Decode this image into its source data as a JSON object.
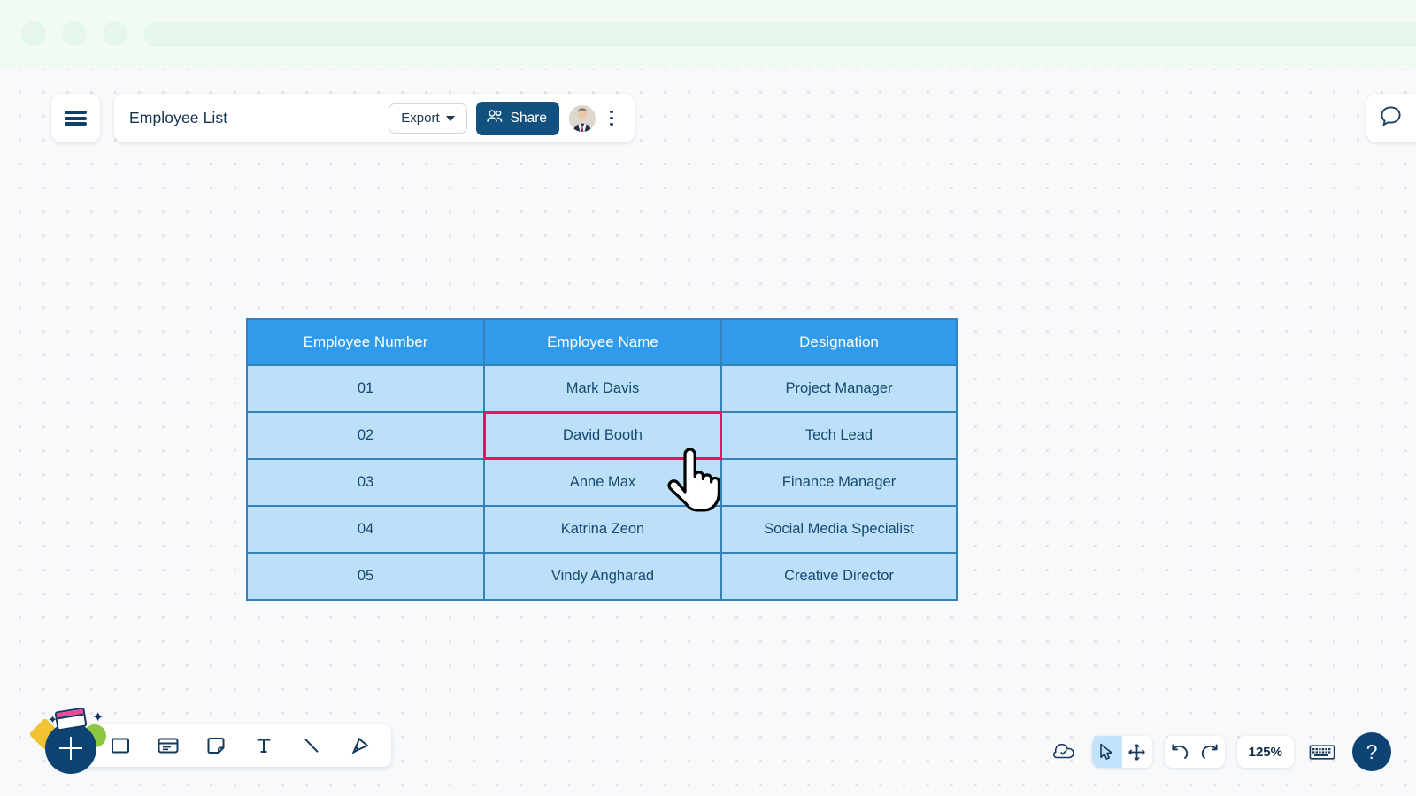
{
  "window": {
    "chrome_dots": [
      "minimize",
      "maximize",
      "close"
    ]
  },
  "toolbar": {
    "menu_icon": "hamburger-menu-icon",
    "doc_title": "Employee List",
    "export_label": "Export",
    "export_caret_icon": "chevron-down-icon",
    "share_label": "Share",
    "share_icon": "people-icon",
    "avatar_name": "user-avatar",
    "more_icon": "kebab-menu-icon",
    "comment_icon": "comment-bubble-icon"
  },
  "table": {
    "headers": [
      "Employee Number",
      "Employee Name",
      "Designation"
    ],
    "rows": [
      [
        "01",
        "Mark Davis",
        "Project Manager"
      ],
      [
        "02",
        "David Booth",
        "Tech Lead"
      ],
      [
        "03",
        "Anne Max",
        "Finance Manager"
      ],
      [
        "04",
        "Katrina Zeon",
        "Social Media Specialist"
      ],
      [
        "05",
        "Vindy Angharad",
        "Creative Director"
      ]
    ],
    "selected_cell": {
      "row": 1,
      "col": 1,
      "value": "David Booth"
    },
    "header_bg": "#2f9bea",
    "cell_bg": "#bce0fa",
    "border_color": "#3581b8",
    "selection_color": "#ec1164",
    "text_color": "#16496f"
  },
  "tool_dock": {
    "add_label": "+",
    "tools": [
      {
        "name": "shape-rectangle-icon",
        "label": "Rectangle"
      },
      {
        "name": "card-icon",
        "label": "Card"
      },
      {
        "name": "sticky-note-icon",
        "label": "Sticky Note"
      },
      {
        "name": "text-icon",
        "label": "Text"
      },
      {
        "name": "line-icon",
        "label": "Line"
      },
      {
        "name": "pen-icon",
        "label": "Pen"
      }
    ],
    "decorations": [
      "yellow-diamond",
      "green-circle",
      "sticky-note-sticker",
      "star",
      "star"
    ]
  },
  "bottom_right": {
    "cloud_saved_icon": "cloud-check-icon",
    "select_tool_icon": "cursor-arrow-icon",
    "pan_tool_icon": "move-arrows-icon",
    "undo_icon": "undo-arrow-icon",
    "redo_icon": "redo-arrow-icon",
    "zoom_level": "125%",
    "keyboard_icon": "keyboard-icon",
    "help_label": "?"
  },
  "colors": {
    "accent_navy": "#0d4373",
    "share_navy": "#11507f",
    "canvas_bg": "#f7f9fb",
    "chrome_bg": "#f1fbf4"
  }
}
